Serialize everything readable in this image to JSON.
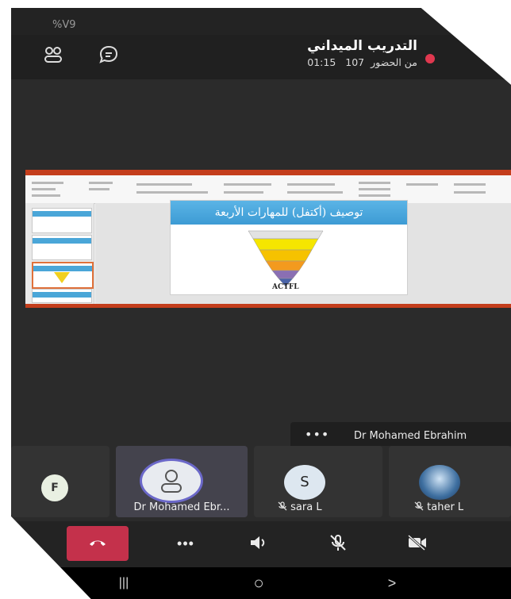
{
  "status_bar": {
    "battery": "%V9"
  },
  "meeting": {
    "title": "التدريب الميداني",
    "duration": "01:15",
    "attendance_count": "107",
    "attendance_suffix": "من الحضور",
    "recording_color": "#e0384f"
  },
  "top_icons": [
    "participants-icon",
    "chat-icon"
  ],
  "shared_content": {
    "slide_title": "توصيف (أكتفل) للمهارات الأربعة",
    "logo_text": "ACTFL"
  },
  "spotlight": {
    "name": "Dr Mohamed Ebrahim",
    "more_label": "•••"
  },
  "participants": [
    {
      "initial": "F",
      "name": "",
      "avatar_color": "#e9f0e2"
    },
    {
      "initial": "",
      "name": "Dr Mohamed Ebr...",
      "avatar_color": "#e8ebf0",
      "icon": "person-icon",
      "active": true
    },
    {
      "initial": "S",
      "name": "sara L",
      "avatar_color": "#dde7f0",
      "muted": true
    },
    {
      "initial": "",
      "name": "taher L",
      "avatar_color": "#3e6fa0",
      "muted": true
    }
  ],
  "controls": {
    "hangup_color": "#c4314b",
    "more_label": "•••",
    "speaker_icon": "speaker-icon",
    "mic_icon": "mic-off-icon",
    "camera_icon": "camera-off-icon"
  },
  "nav": {
    "recents": "|||",
    "home": "○",
    "back": ">"
  }
}
